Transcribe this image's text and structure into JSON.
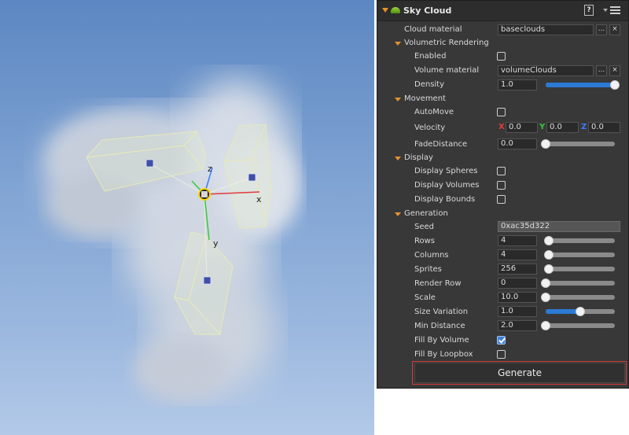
{
  "viewport": {
    "axis_labels": {
      "x": "x",
      "y": "y",
      "z": "z"
    }
  },
  "panel": {
    "title": "Sky Cloud",
    "help_icon": "help-icon",
    "menu_icon": "menu-icon",
    "cloud_material": {
      "label": "Cloud material",
      "value": "baseclouds",
      "browse": "...",
      "clear": "×"
    },
    "volumetric": {
      "header": "Volumetric Rendering",
      "enabled": {
        "label": "Enabled",
        "checked": false
      },
      "volume_material": {
        "label": "Volume material",
        "value": "volumeClouds",
        "browse": "...",
        "clear": "×"
      },
      "density": {
        "label": "Density",
        "value": "1.0",
        "slider_fraction": 1.0
      }
    },
    "movement": {
      "header": "Movement",
      "automove": {
        "label": "AutoMove",
        "checked": false
      },
      "velocity": {
        "label": "Velocity",
        "x_label": "X",
        "x": "0.0",
        "y_label": "Y",
        "y": "0.0",
        "z_label": "Z",
        "z": "0.0"
      },
      "fade_distance": {
        "label": "FadeDistance",
        "value": "0.0",
        "slider_fraction": 0.0
      }
    },
    "display": {
      "header": "Display",
      "spheres": {
        "label": "Display Spheres",
        "checked": false
      },
      "volumes": {
        "label": "Display Volumes",
        "checked": false
      },
      "bounds": {
        "label": "Display Bounds",
        "checked": false
      }
    },
    "generation": {
      "header": "Generation",
      "seed": {
        "label": "Seed",
        "value": "0xac35d322"
      },
      "rows": {
        "label": "Rows",
        "value": "4",
        "slider_fraction": 0.02
      },
      "columns": {
        "label": "Columns",
        "value": "4",
        "slider_fraction": 0.02
      },
      "sprites": {
        "label": "Sprites",
        "value": "256",
        "slider_fraction": 0.02
      },
      "render_row": {
        "label": "Render Row",
        "value": "0",
        "slider_fraction": 0.0
      },
      "scale": {
        "label": "Scale",
        "value": "10.0",
        "slider_fraction": 0.0
      },
      "size_variation": {
        "label": "Size Variation",
        "value": "1.0",
        "slider_fraction": 0.5
      },
      "min_distance": {
        "label": "Min Distance",
        "value": "2.0",
        "slider_fraction": 0.0
      },
      "fill_by_volume": {
        "label": "Fill By Volume",
        "checked": true
      },
      "fill_by_loopbox": {
        "label": "Fill By Loopbox",
        "checked": false
      }
    },
    "generate_button": "Generate"
  },
  "colors": {
    "panel_bg": "#383838",
    "accent_orange": "#e8912a",
    "slider_blue": "#2c7ad6",
    "highlight_red": "#d63a3a",
    "axis_x": "#e23b3b",
    "axis_y": "#35c93a",
    "axis_z": "#3a7bff"
  }
}
